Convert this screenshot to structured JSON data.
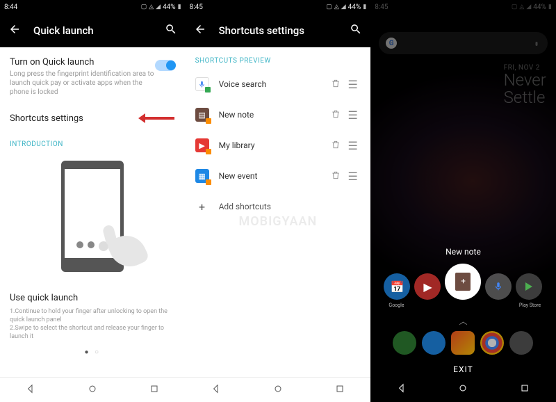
{
  "p1": {
    "status_time": "8:44",
    "battery": "44%",
    "toolbar_title": "Quick launch",
    "quick_launch": {
      "title": "Turn on Quick launch",
      "subtitle": "Long press the fingerprint identification area to launch quick pay or activate apps when the phone is locked"
    },
    "shortcuts_settings_label": "Shortcuts settings",
    "intro_label": "INTRODUCTION",
    "use_title": "Use quick launch",
    "use_sub": "1.Continue to hold your finger after unlocking to open the quick launch panel\n2.Swipe to select the shortcut and release your finger to launch it"
  },
  "p2": {
    "status_time": "8:45",
    "battery": "44%",
    "toolbar_title": "Shortcuts settings",
    "section_label": "SHORTCUTS PREVIEW",
    "items": [
      {
        "label": "Voice search"
      },
      {
        "label": "New note"
      },
      {
        "label": "My library"
      },
      {
        "label": "New event"
      }
    ],
    "add_label": "Add shortcuts",
    "watermark": "MOBIGYAAN"
  },
  "p3": {
    "status_time": "8:45",
    "battery": "44%",
    "widget_date": "FRI, NOV 2",
    "widget_line1": "Never",
    "widget_line2": "Settle",
    "selected_label": "New note",
    "chip_left_label": "Google",
    "chip_right_label": "Play Store",
    "exit_label": "EXIT"
  }
}
